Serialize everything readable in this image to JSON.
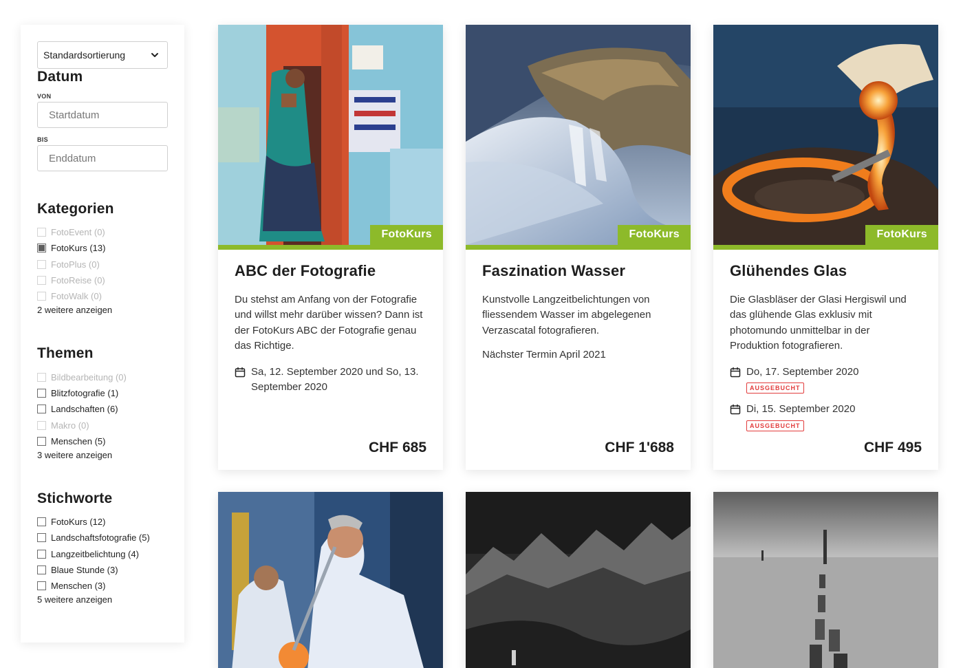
{
  "sidebar": {
    "sort": {
      "value": "Standardsortierung"
    },
    "datum": {
      "title": "Datum",
      "from_label": "VON",
      "from_placeholder": "Startdatum",
      "to_label": "BIS",
      "to_placeholder": "Enddatum"
    },
    "kategorien": {
      "title": "Kategorien",
      "items": [
        {
          "label": "FotoEvent (0)",
          "checked": false,
          "disabled": true
        },
        {
          "label": "FotoKurs (13)",
          "checked": true,
          "disabled": false
        },
        {
          "label": "FotoPlus (0)",
          "checked": false,
          "disabled": true
        },
        {
          "label": "FotoReise (0)",
          "checked": false,
          "disabled": true
        },
        {
          "label": "FotoWalk (0)",
          "checked": false,
          "disabled": true
        }
      ],
      "more": "2 weitere anzeigen"
    },
    "themen": {
      "title": "Themen",
      "items": [
        {
          "label": "Bildbearbeitung (0)",
          "checked": false,
          "disabled": true
        },
        {
          "label": "Blitzfotografie (1)",
          "checked": false,
          "disabled": false
        },
        {
          "label": "Landschaften (6)",
          "checked": false,
          "disabled": false
        },
        {
          "label": "Makro (0)",
          "checked": false,
          "disabled": true
        },
        {
          "label": "Menschen (5)",
          "checked": false,
          "disabled": false
        }
      ],
      "more": "3 weitere anzeigen"
    },
    "stichworte": {
      "title": "Stichworte",
      "items": [
        {
          "label": "FotoKurs (12)",
          "checked": false,
          "disabled": false
        },
        {
          "label": "Landschaftsfotografie (5)",
          "checked": false,
          "disabled": false
        },
        {
          "label": "Langzeitbelichtung (4)",
          "checked": false,
          "disabled": false
        },
        {
          "label": "Blaue Stunde (3)",
          "checked": false,
          "disabled": false
        },
        {
          "label": "Menschen (3)",
          "checked": false,
          "disabled": false
        }
      ],
      "more": "5 weitere anzeigen"
    }
  },
  "cards": [
    {
      "badge": "FotoKurs",
      "title": "ABC der Fotografie",
      "description": "Du stehst am Anfang von der Fotografie und willst mehr darüber wissen? Dann ist der FotoKurs ABC der Fotografie genau das Richtige.",
      "date": "Sa, 12. September 2020 und So, 13. September 2020",
      "price": "CHF 685"
    },
    {
      "badge": "FotoKurs",
      "title": "Faszination Wasser",
      "description": "Kunstvolle Langzeitbelichtungen von fliessendem Wasser im abgelegenen Verzascatal fotografieren.",
      "next": "Nächster Termin April 2021",
      "price": "CHF 1'688"
    },
    {
      "badge": "FotoKurs",
      "title": "Glühendes Glas",
      "description": "Die Glasbläser der Glasi Hergiswil und das glühende Glas exklusiv mit photomundo unmittelbar in der Produktion fotografieren.",
      "dates": [
        {
          "date": "Do, 17. September 2020",
          "status": "AUSGEBUCHT"
        },
        {
          "date": "Di, 15. September 2020",
          "status": "AUSGEBUCHT"
        }
      ],
      "price": "CHF 495"
    }
  ],
  "colors": {
    "accent_green": "#8dba2a",
    "sold_out_red": "#e23b3b"
  }
}
